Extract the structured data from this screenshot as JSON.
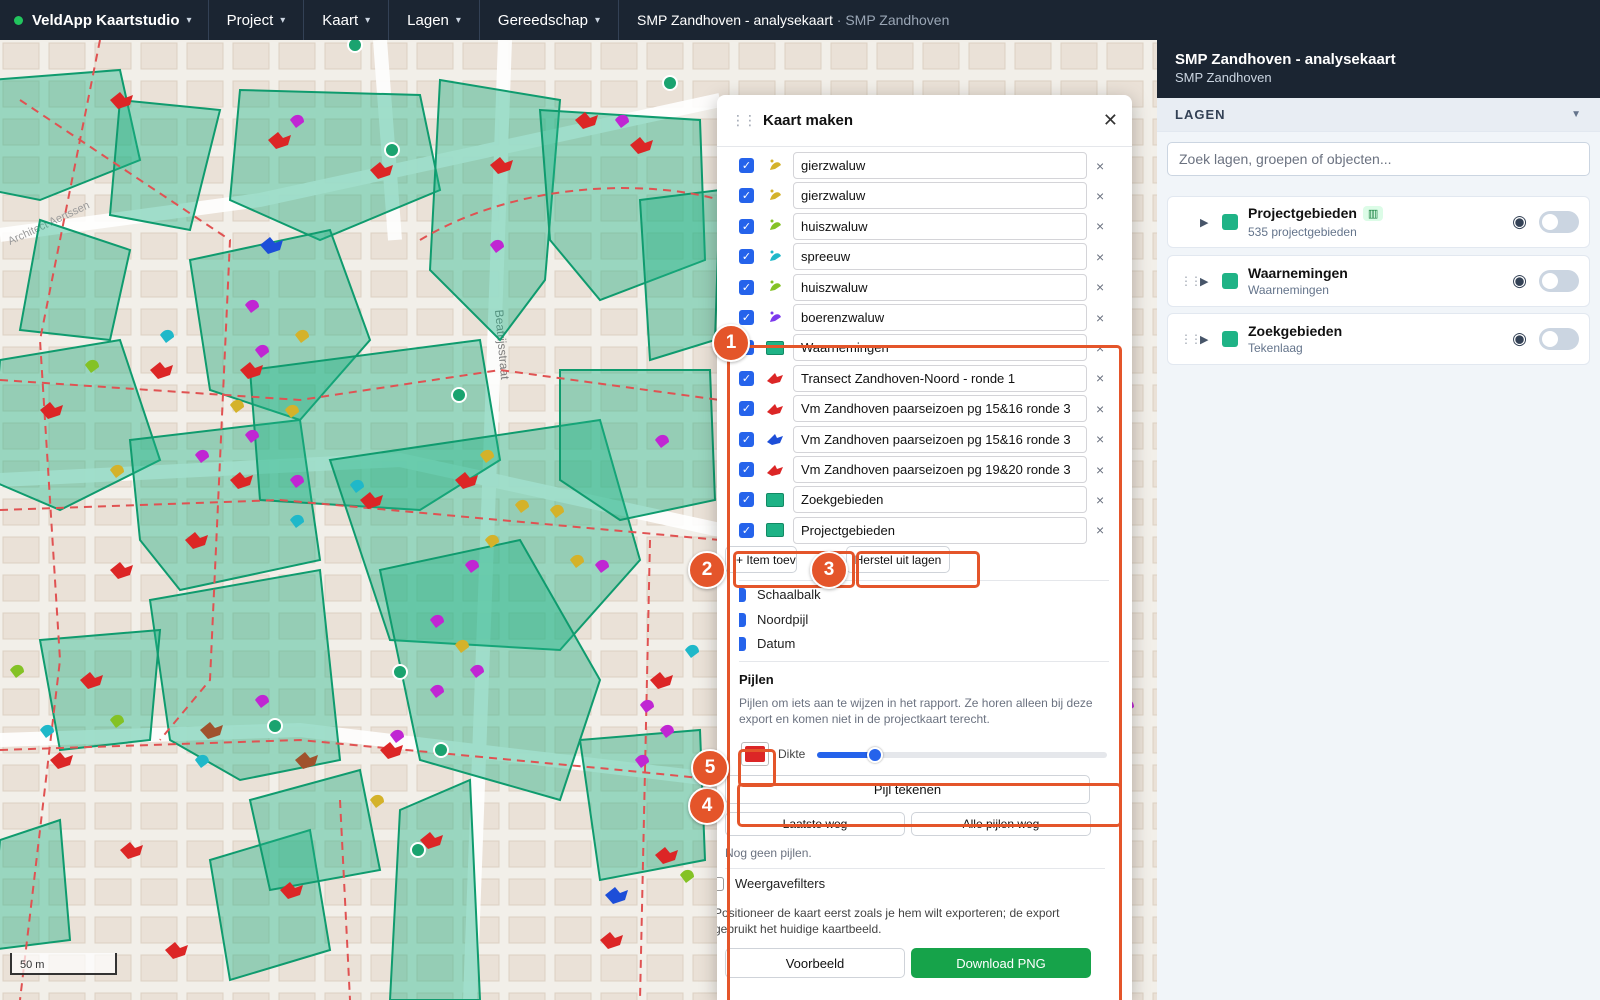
{
  "app": {
    "name": "VeldApp Kaartstudio"
  },
  "menu": [
    "Project",
    "Kaart",
    "Lagen",
    "Gereedschap"
  ],
  "breadcrumb": {
    "project": "SMP Zandhoven - analysekaart",
    "separator": "·",
    "sub": "SMP Zandhoven"
  },
  "map": {
    "scale_label": "50 m",
    "street_label": "Beatrijsstraat",
    "street_label2": "Architect Aertssen"
  },
  "panel": {
    "title": "Kaart maken",
    "legend_items": [
      {
        "label": "gierzwaluw",
        "symbol": "bird-icon",
        "color": "#d4b22a"
      },
      {
        "label": "gierzwaluw",
        "symbol": "bird-icon",
        "color": "#d4b22a"
      },
      {
        "label": "huiszwaluw",
        "symbol": "bird-icon",
        "color": "#84c225"
      },
      {
        "label": "spreeuw",
        "symbol": "bird-icon",
        "color": "#1fb8c9"
      },
      {
        "label": "huiszwaluw",
        "symbol": "bird-icon",
        "color": "#84c225"
      },
      {
        "label": "boerenzwaluw",
        "symbol": "bird-icon",
        "color": "#7c3aed"
      },
      {
        "label": "Waarnemingen",
        "symbol": "area-swatch",
        "color": "#1fb386"
      },
      {
        "label": "Transect Zandhoven-Noord - ronde 1",
        "symbol": "bat-icon",
        "color": "#dc2626"
      },
      {
        "label": "Vm Zandhoven paarseizoen pg 15&16 ronde 3",
        "symbol": "bat-icon",
        "color": "#dc2626"
      },
      {
        "label": "Vm Zandhoven paarseizoen pg 15&16 ronde 3",
        "symbol": "bat-icon",
        "color": "#1d4ed8"
      },
      {
        "label": "Vm Zandhoven paarseizoen pg 19&20 ronde 3",
        "symbol": "bat-icon",
        "color": "#dc2626"
      },
      {
        "label": "Zoekgebieden",
        "symbol": "area-swatch",
        "color": "#1fb386"
      },
      {
        "label": "Projectgebieden",
        "symbol": "area-swatch",
        "color": "#1fb386"
      }
    ],
    "add_item": "+ Item toevoegen",
    "restore": "Herstel uit lagen",
    "options": [
      "Schaalbalk",
      "Noordpijl",
      "Datum"
    ],
    "arrows_title": "Pijlen",
    "arrows_desc": "Pijlen om iets aan te wijzen in het rapport. Ze horen alleen bij deze export en komen niet in de projectkaart terecht.",
    "arrow_color": "#dc2626",
    "thickness_label": "Dikte",
    "thickness_value": 0.2,
    "draw_arrow": "Pijl tekenen",
    "undo_last": "Laatste weg",
    "clear_all": "Alle pijlen weg",
    "no_arrows": "Nog geen pijlen.",
    "filters": "Weergavefilters",
    "position_hint": "Positioneer de kaart eerst zoals je hem wilt exporteren; de export gebruikt het huidige kaartbeeld.",
    "preview": "Voorbeeld",
    "download": "Download PNG"
  },
  "callouts": [
    "1",
    "2",
    "3",
    "4",
    "5"
  ],
  "right": {
    "title": "SMP Zandhoven - analysekaart",
    "subtitle": "SMP Zandhoven",
    "section": "LAGEN",
    "search_placeholder": "Zoek lagen, groepen of objecten...",
    "layers": [
      {
        "name": "Projectgebieden",
        "sub": "535 projectgebieden",
        "badge": "map-icon"
      },
      {
        "name": "Waarnemingen",
        "sub": "Waarnemingen"
      },
      {
        "name": "Zoekgebieden",
        "sub": "Tekenlaag"
      }
    ]
  }
}
